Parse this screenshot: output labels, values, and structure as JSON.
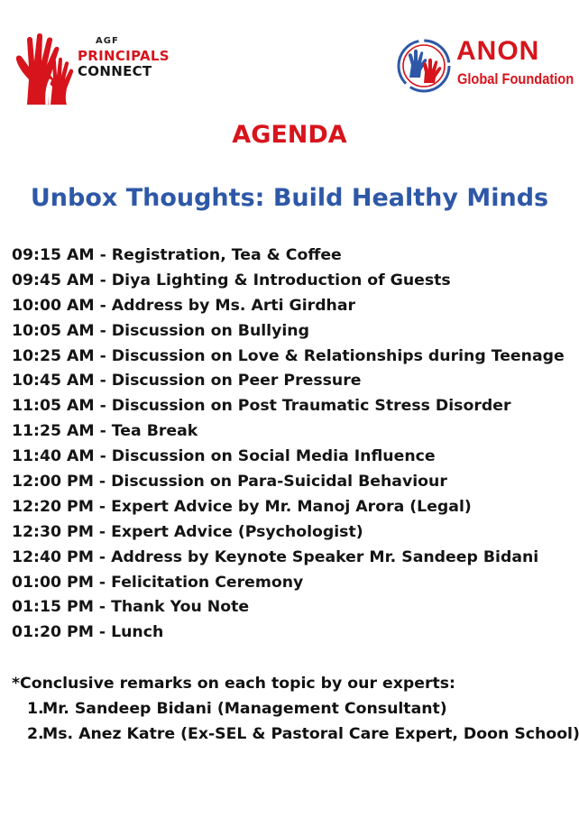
{
  "logos": {
    "left": {
      "line1": "AGF",
      "line2": "PRINCIPALS",
      "line3": "CONNECT",
      "icon": "raised-hands-icon"
    },
    "right": {
      "line1": "ANON",
      "line2": "Global Foundation",
      "icon": "hands-circle-icon"
    }
  },
  "colors": {
    "red": "#d7141c",
    "blue": "#2e58a7",
    "text": "#141414"
  },
  "heading": "AGENDA",
  "subtitle": "Unbox Thoughts: Build Healthy Minds",
  "schedule": [
    "09:15 AM - Registration, Tea & Coffee",
    "09:45 AM - Diya Lighting & Introduction of Guests",
    "10:00 AM - Address by Ms. Arti Girdhar",
    "10:05 AM - Discussion on Bullying",
    "10:25 AM - Discussion on Love & Relationships during Teenage",
    "10:45 AM - Discussion on Peer Pressure",
    "11:05 AM - Discussion on Post Traumatic Stress Disorder",
    "11:25 AM - Tea Break",
    "11:40 AM - Discussion on Social Media Influence",
    "12:00 PM - Discussion on Para-Suicidal Behaviour",
    "12:20 PM - Expert Advice by Mr. Manoj Arora (Legal)",
    "12:30 PM - Expert Advice (Psychologist)",
    "12:40 PM - Address by Keynote Speaker Mr. Sandeep Bidani",
    "01:00 PM - Felicitation Ceremony",
    "01:15 PM - Thank You Note",
    "01:20 PM - Lunch"
  ],
  "remarks": {
    "intro": "*Conclusive remarks on each topic by our experts:",
    "experts": [
      {
        "num": "1.",
        "text": "Mr. Sandeep Bidani (Management Consultant)"
      },
      {
        "num": "2.",
        "text": "Ms. Anez Katre (Ex-SEL & Pastoral Care Expert, Doon School)"
      }
    ]
  }
}
